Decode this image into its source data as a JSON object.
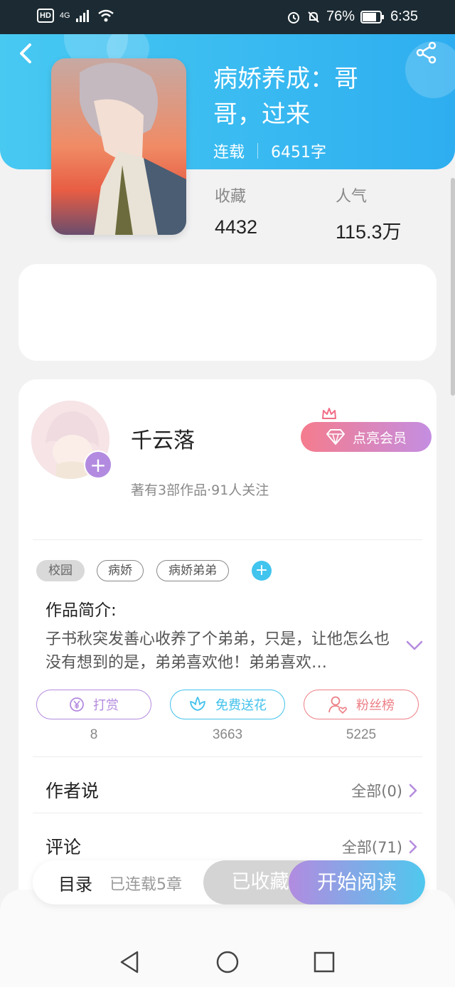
{
  "status_bar": {
    "hd": "HD",
    "signal": "4G",
    "battery": "76%",
    "time": "6:35"
  },
  "book": {
    "title": "病娇养成：哥哥，过来",
    "status": "连载",
    "word_count": "6451字"
  },
  "stats": {
    "favorites_label": "收藏",
    "favorites_value": "4432",
    "popularity_label": "人气",
    "popularity_value": "115.3万"
  },
  "author": {
    "name": "千云落",
    "info": "著有3部作品·91人关注",
    "vip_label": "点亮会员"
  },
  "tags": [
    {
      "label": "校园"
    },
    {
      "label": "病娇"
    },
    {
      "label": "病娇弟弟"
    }
  ],
  "intro": {
    "title": "作品简介:",
    "text": "子书秋突发善心收养了个弟弟，只是，让他怎么也没有想到的是，弟弟喜欢他！弟弟喜欢…"
  },
  "actions": [
    {
      "label": "打赏",
      "count": "8",
      "color": "#b48bde"
    },
    {
      "label": "免费送花",
      "count": "3663",
      "color": "#43c2ec"
    },
    {
      "label": "粉丝榜",
      "count": "5225",
      "color": "#ec7f86"
    }
  ],
  "author_says": {
    "title": "作者说",
    "link": "全部(0)"
  },
  "comments": {
    "title": "评论",
    "link": "全部(71)"
  },
  "bottom_bar": {
    "toc_label": "目录",
    "toc_status": "已连载5章",
    "collected_label": "已收藏",
    "read_label": "开始阅读"
  },
  "icons": {
    "back": "back-arrow-icon",
    "share": "share-icon",
    "nav_back": "triangle-back-icon",
    "nav_home": "circle-home-icon",
    "nav_recent": "square-recent-icon"
  }
}
